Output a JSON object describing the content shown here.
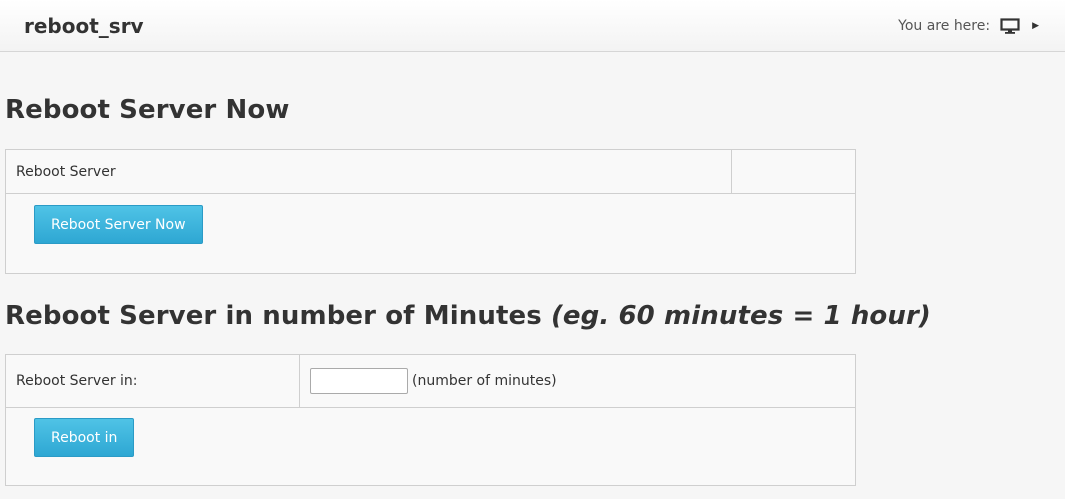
{
  "header": {
    "title": "reboot_srv",
    "breadcrumb_label": "You are here:",
    "breadcrumb_icon": "monitor-icon"
  },
  "section_now": {
    "heading": "Reboot Server Now",
    "row_label": "Reboot Server",
    "button_label": "Reboot Server Now"
  },
  "section_minutes": {
    "heading": "Reboot Server in number of Minutes",
    "heading_note": "(eg. 60 minutes = 1 hour)",
    "row_label": "Reboot Server in:",
    "input_value": "",
    "input_hint": "(number of minutes)",
    "button_label": "Reboot in"
  },
  "colors": {
    "button": "#34aed8",
    "border": "#cfcfcf"
  }
}
